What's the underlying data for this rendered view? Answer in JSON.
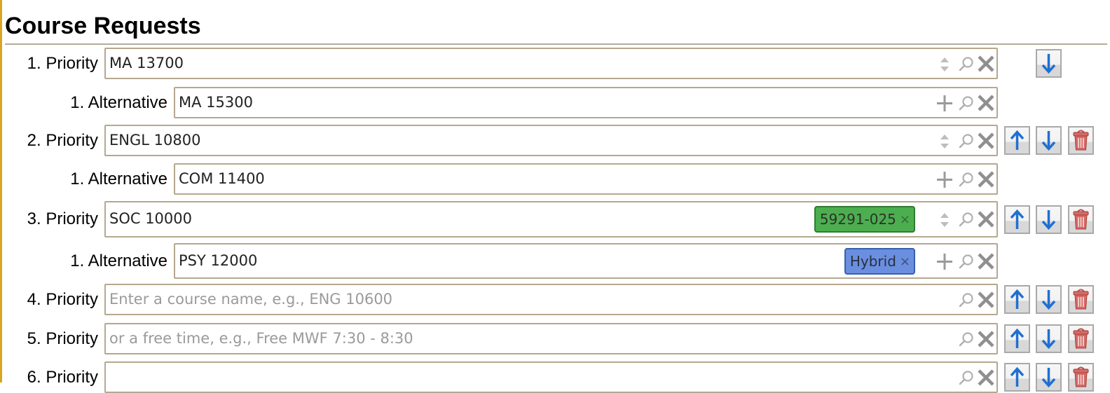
{
  "page": {
    "title": "Course Requests"
  },
  "rows": [
    {
      "label": "1. Priority",
      "kind": "priority",
      "value": "MA 13700",
      "placeholder": "",
      "controls": [
        "updown-icon",
        "search-icon",
        "clear-icon"
      ],
      "buttons": [
        "move-down"
      ]
    },
    {
      "label": "1. Alternative",
      "kind": "alternative",
      "value": "MA 15300",
      "placeholder": "",
      "controls": [
        "add-icon",
        "search-icon",
        "clear-icon"
      ],
      "buttons": []
    },
    {
      "label": "2. Priority",
      "kind": "priority",
      "value": "ENGL 10800",
      "placeholder": "",
      "controls": [
        "updown-icon",
        "search-icon",
        "clear-icon"
      ],
      "buttons": [
        "move-up",
        "move-down",
        "delete"
      ]
    },
    {
      "label": "1. Alternative",
      "kind": "alternative",
      "value": "COM 11400",
      "placeholder": "",
      "controls": [
        "add-icon",
        "search-icon",
        "clear-icon"
      ],
      "buttons": []
    },
    {
      "label": "3. Priority",
      "kind": "priority",
      "value": "SOC 10000",
      "placeholder": "",
      "chip": {
        "text": "59291-025",
        "color": "#4cae4f",
        "remove": "×"
      },
      "controls": [
        "updown-icon",
        "search-icon",
        "clear-icon"
      ],
      "buttons": [
        "move-up",
        "move-down",
        "delete"
      ]
    },
    {
      "label": "1. Alternative",
      "kind": "alternative",
      "value": "PSY 12000",
      "placeholder": "",
      "chip": {
        "text": "Hybrid",
        "color": "#6a8fe0",
        "remove": "×"
      },
      "controls": [
        "add-icon",
        "search-icon",
        "clear-icon"
      ],
      "buttons": []
    },
    {
      "label": "4. Priority",
      "kind": "priority",
      "value": "",
      "placeholder": "Enter a course name, e.g., ENG 10600",
      "controls": [
        "search-icon",
        "clear-icon"
      ],
      "buttons": [
        "move-up",
        "move-down",
        "delete"
      ]
    },
    {
      "label": "5. Priority",
      "kind": "priority",
      "value": "",
      "placeholder": "or a free time, e.g., Free MWF 7:30 - 8:30",
      "controls": [
        "search-icon",
        "clear-icon"
      ],
      "buttons": [
        "move-up",
        "move-down",
        "delete"
      ]
    },
    {
      "label": "6. Priority",
      "kind": "priority",
      "value": "",
      "placeholder": "",
      "controls": [
        "search-icon",
        "clear-icon"
      ],
      "buttons": [
        "move-up",
        "move-down",
        "delete"
      ]
    }
  ],
  "colors": {
    "accent_left_rule": "#d9a520",
    "field_border": "#b5a88f",
    "arrow_blue": "#1f6fd1",
    "delete_red": "#c0504d"
  }
}
